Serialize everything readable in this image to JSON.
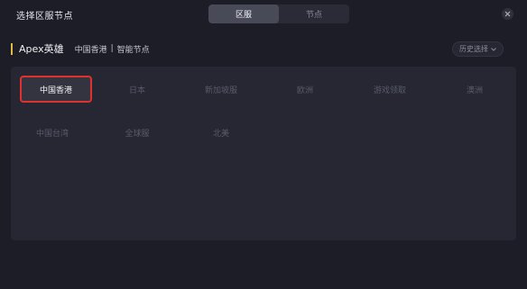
{
  "dialog": {
    "title": "选择区服节点"
  },
  "tabs": [
    {
      "label": "区服",
      "active": true
    },
    {
      "label": "节点",
      "active": false
    }
  ],
  "header": {
    "game_title": "Apex英雄",
    "crumb_region": "中国香港",
    "crumb_separator": "|",
    "crumb_node": "智能节点"
  },
  "history_button": {
    "label": "历史选择"
  },
  "regions": {
    "row1": [
      "中国香港",
      "日本",
      "新加坡服",
      "欧洲",
      "游戏领取",
      "澳洲"
    ],
    "row2": [
      "中国台湾",
      "全球服",
      "北美"
    ],
    "selected": "中国香港"
  },
  "colors": {
    "accent": "#e0b84a",
    "selection_border": "#e03131",
    "background": "#1d1d27",
    "panel": "#262733"
  }
}
